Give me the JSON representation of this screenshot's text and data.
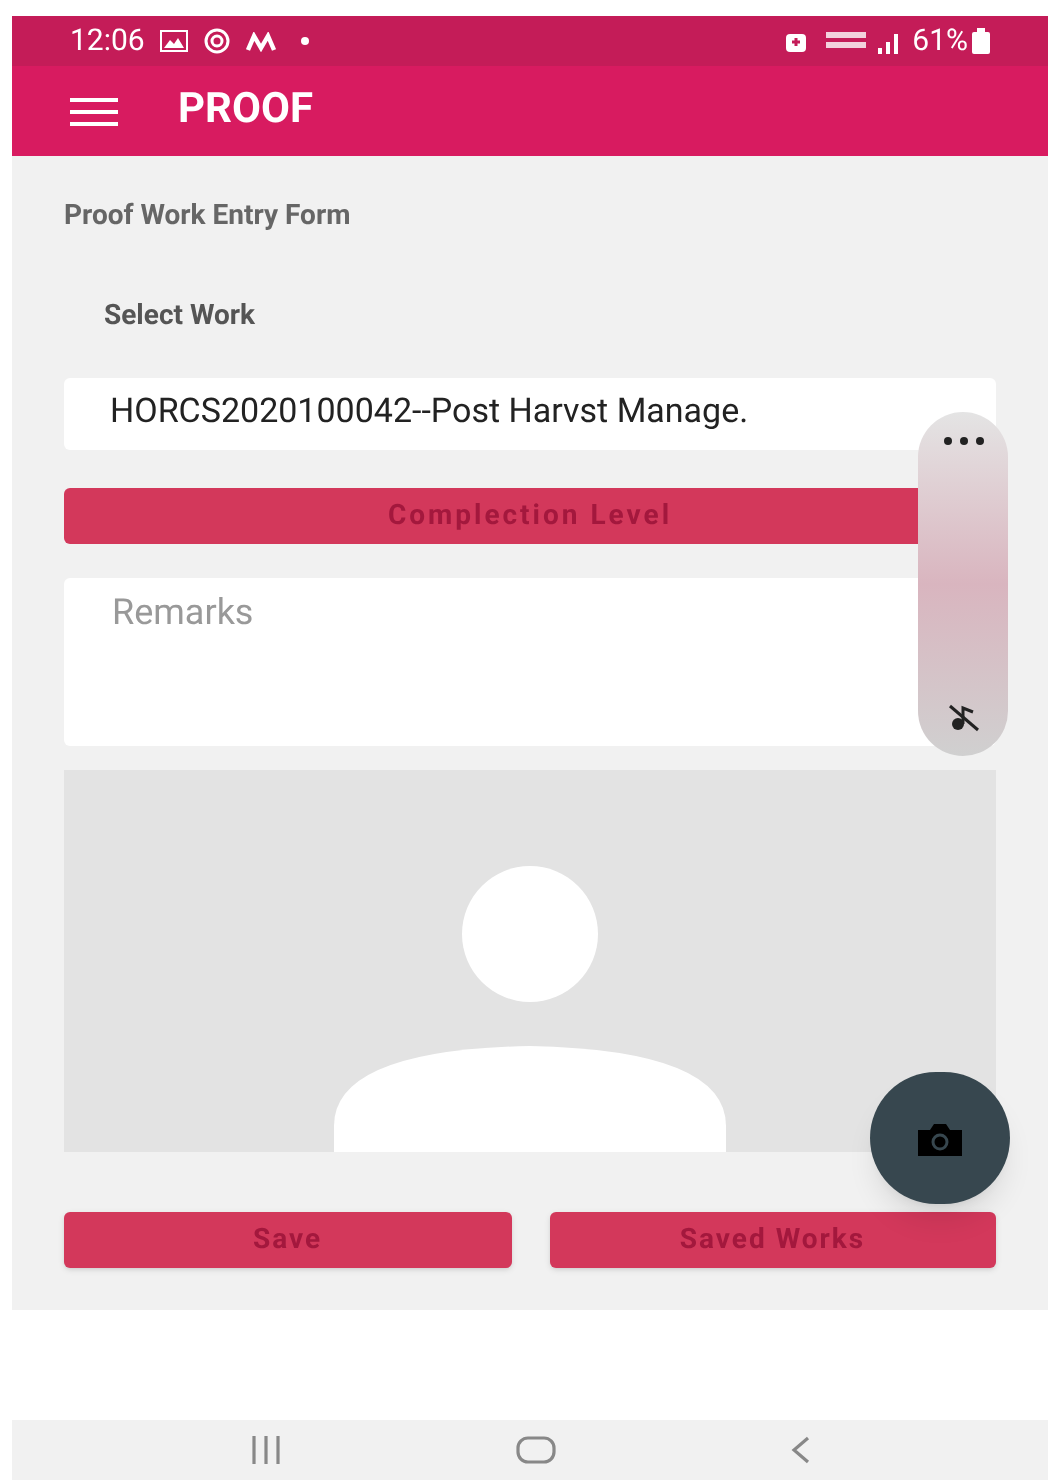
{
  "status_bar": {
    "time": "12:06",
    "battery": "61%"
  },
  "app_bar": {
    "title": "PROOF"
  },
  "form": {
    "title": "Proof Work Entry Form",
    "select_label": "Select Work",
    "selected_work": "HORCS2020100042--Post Harvst Manage.",
    "completion_button": "Complection Level",
    "remarks": {
      "placeholder": "Remarks"
    }
  },
  "buttons": [
    "Save",
    "Saved Works"
  ]
}
